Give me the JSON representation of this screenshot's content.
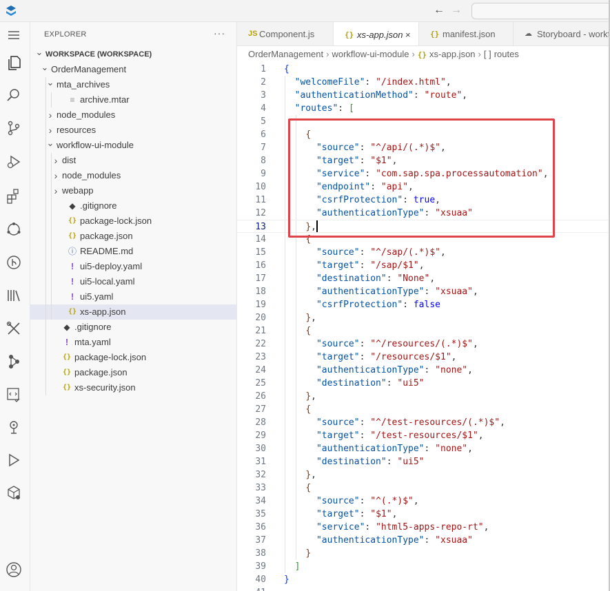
{
  "titlebar": {
    "back_icon": "arrow-left-icon",
    "forward_icon": "arrow-right-icon"
  },
  "activity_bar": [
    {
      "name": "menu",
      "icon": "hamburger-menu-icon"
    },
    {
      "name": "explorer",
      "icon": "files-icon"
    },
    {
      "name": "search",
      "icon": "search-icon"
    },
    {
      "name": "source-control",
      "icon": "source-control-icon"
    },
    {
      "name": "run-debug",
      "icon": "run-debug-icon"
    },
    {
      "name": "extensions",
      "icon": "extensions-icon"
    },
    {
      "name": "remote",
      "icon": "remote-icon"
    },
    {
      "name": "git-graph",
      "icon": "git-graph-icon"
    },
    {
      "name": "library",
      "icon": "library-icon"
    },
    {
      "name": "tools",
      "icon": "tools-icon"
    },
    {
      "name": "process",
      "icon": "process-icon"
    },
    {
      "name": "code-review",
      "icon": "code-check-icon"
    },
    {
      "name": "storyboard",
      "icon": "pin-icon"
    },
    {
      "name": "run",
      "icon": "play-icon"
    },
    {
      "name": "cube",
      "icon": "cube-icon"
    },
    {
      "name": "account",
      "icon": "account-icon"
    }
  ],
  "sidebar": {
    "title": "EXPLORER",
    "more": "···",
    "tree": [
      {
        "label": "WORKSPACE (WORKSPACE)",
        "depth": 0,
        "chevron": "down",
        "icon": "",
        "bold": true
      },
      {
        "label": "OrderManagement",
        "depth": 1,
        "chevron": "down",
        "icon": ""
      },
      {
        "label": "mta_archives",
        "depth": 2,
        "chevron": "down",
        "icon": ""
      },
      {
        "label": "archive.mtar",
        "depth": 3,
        "chevron": "",
        "icon": "file"
      },
      {
        "label": "node_modules",
        "depth": 2,
        "chevron": "right",
        "icon": ""
      },
      {
        "label": "resources",
        "depth": 2,
        "chevron": "right",
        "icon": ""
      },
      {
        "label": "workflow-ui-module",
        "depth": 2,
        "chevron": "down",
        "icon": ""
      },
      {
        "label": "dist",
        "depth": 3,
        "chevron": "right",
        "icon": ""
      },
      {
        "label": "node_modules",
        "depth": 3,
        "chevron": "right",
        "icon": ""
      },
      {
        "label": "webapp",
        "depth": 3,
        "chevron": "right",
        "icon": ""
      },
      {
        "label": ".gitignore",
        "depth": 3,
        "chevron": "",
        "icon": "git"
      },
      {
        "label": "package-lock.json",
        "depth": 3,
        "chevron": "",
        "icon": "json"
      },
      {
        "label": "package.json",
        "depth": 3,
        "chevron": "",
        "icon": "json"
      },
      {
        "label": "README.md",
        "depth": 3,
        "chevron": "",
        "icon": "info"
      },
      {
        "label": "ui5-deploy.yaml",
        "depth": 3,
        "chevron": "",
        "icon": "yaml"
      },
      {
        "label": "ui5-local.yaml",
        "depth": 3,
        "chevron": "",
        "icon": "yaml"
      },
      {
        "label": "ui5.yaml",
        "depth": 3,
        "chevron": "",
        "icon": "yaml"
      },
      {
        "label": "xs-app.json",
        "depth": 3,
        "chevron": "",
        "icon": "json",
        "selected": true
      },
      {
        "label": ".gitignore",
        "depth": 2,
        "chevron": "",
        "icon": "git"
      },
      {
        "label": "mta.yaml",
        "depth": 2,
        "chevron": "",
        "icon": "yaml"
      },
      {
        "label": "package-lock.json",
        "depth": 2,
        "chevron": "",
        "icon": "json"
      },
      {
        "label": "package.json",
        "depth": 2,
        "chevron": "",
        "icon": "json"
      },
      {
        "label": "xs-security.json",
        "depth": 2,
        "chevron": "",
        "icon": "json"
      }
    ]
  },
  "tabs": [
    {
      "label": "Component.js",
      "icon": "JS",
      "icon_name": "javascript-file-icon",
      "active": false
    },
    {
      "label": "xs-app.json",
      "icon": "{}",
      "icon_name": "json-file-icon",
      "active": true,
      "close": "×"
    },
    {
      "label": "manifest.json",
      "icon": "{}",
      "icon_name": "json-file-icon",
      "active": false
    },
    {
      "label": "Storyboard - workf",
      "icon": "☁",
      "icon_name": "storyboard-icon",
      "active": false
    }
  ],
  "breadcrumb": {
    "items": [
      "OrderManagement",
      "workflow-ui-module",
      "xs-app.json",
      "routes"
    ],
    "separator": "›",
    "json_icon": "{}",
    "array_icon": "[ ]"
  },
  "editor": {
    "current_line": 13,
    "lines": [
      "{",
      "  \"welcomeFile\": \"/index.html\",",
      "  \"authenticationMethod\": \"route\",",
      "  \"routes\": [",
      "",
      "    {",
      "      \"source\": \"^/api/(.*)$\",",
      "      \"target\": \"$1\",",
      "      \"service\": \"com.sap.spa.processautomation\",",
      "      \"endpoint\": \"api\",",
      "      \"csrfProtection\": true,",
      "      \"authenticationType\": \"xsuaa\"",
      "    },",
      "    {",
      "      \"source\": \"^/sap/(.*)$\",",
      "      \"target\": \"/sap/$1\",",
      "      \"destination\": \"None\",",
      "      \"authenticationType\": \"xsuaa\",",
      "      \"csrfProtection\": false",
      "    },",
      "    {",
      "      \"source\": \"^/resources/(.*)$\",",
      "      \"target\": \"/resources/$1\",",
      "      \"authenticationType\": \"none\",",
      "      \"destination\": \"ui5\"",
      "    },",
      "    {",
      "      \"source\": \"^/test-resources/(.*)$\",",
      "      \"target\": \"/test-resources/$1\",",
      "      \"authenticationType\": \"none\",",
      "      \"destination\": \"ui5\"",
      "    },",
      "    {",
      "      \"source\": \"^(.*)$\",",
      "      \"target\": \"$1\",",
      "      \"service\": \"html5-apps-repo-rt\",",
      "      \"authenticationType\": \"xsuaa\"",
      "    }",
      "  ]",
      "}",
      ""
    ]
  },
  "colors": {
    "highlight_box": "#e0424a",
    "json_key": "#0451a5",
    "json_string": "#a31515",
    "json_keyword": "#0000ff",
    "selected_row": "#e4e6f1"
  }
}
